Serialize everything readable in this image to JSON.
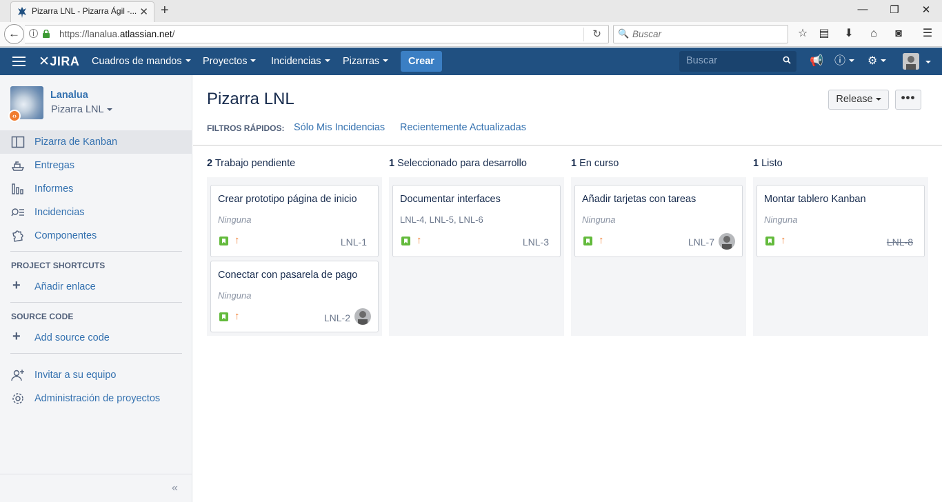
{
  "browser": {
    "tab_title": "Pizarra LNL - Pizarra Ágil -...",
    "url_prefix": "https://lanalua.",
    "url_domain": "atlassian.net",
    "url_suffix": "/",
    "search_placeholder": "Buscar"
  },
  "header": {
    "logo": "JIRA",
    "nav": [
      "Cuadros de mandos",
      "Proyectos",
      "Incidencias",
      "Pizarras"
    ],
    "create_label": "Crear",
    "search_placeholder": "Buscar"
  },
  "sidebar": {
    "project_name": "Lanalua",
    "board_name": "Pizarra LNL",
    "items": [
      {
        "label": "Pizarra de Kanban",
        "icon": "board-icon",
        "active": true
      },
      {
        "label": "Entregas",
        "icon": "ship-icon"
      },
      {
        "label": "Informes",
        "icon": "reports-icon"
      },
      {
        "label": "Incidencias",
        "icon": "issues-icon"
      },
      {
        "label": "Componentes",
        "icon": "components-icon"
      }
    ],
    "project_shortcuts_heading": "PROJECT SHORTCUTS",
    "add_link_label": "Añadir enlace",
    "source_code_heading": "SOURCE CODE",
    "add_source_label": "Add source code",
    "invite_label": "Invitar a su equipo",
    "admin_label": "Administración de proyectos",
    "collapse_glyph": "«"
  },
  "board": {
    "title": "Pizarra LNL",
    "release_label": "Release",
    "more_label": "•••",
    "quick_filters_label": "FILTROS RÁPIDOS:",
    "quick_filters": [
      "Sólo Mis Incidencias",
      "Recientemente Actualizadas"
    ],
    "columns": [
      {
        "count": "2",
        "name": "Trabajo pendiente",
        "cards": [
          {
            "title": "Crear prototipo página de inicio",
            "epic": "Ninguna",
            "key": "LNL-1"
          },
          {
            "title": "Conectar con pasarela de pago",
            "epic": "Ninguna",
            "key": "LNL-2"
          }
        ]
      },
      {
        "count": "1",
        "name": "Seleccionado para desarrollo",
        "cards": [
          {
            "title": "Documentar interfaces",
            "epic": "LNL-4, LNL-5, LNL-6",
            "key": "LNL-3"
          }
        ]
      },
      {
        "count": "1",
        "name": "En curso",
        "cards": [
          {
            "title": "Añadir tarjetas con tareas",
            "epic": "Ninguna",
            "key": "LNL-7"
          }
        ]
      },
      {
        "count": "1",
        "name": "Listo",
        "cards": [
          {
            "title": "Montar tablero Kanban",
            "epic": "Ninguna",
            "key": "LNL-8"
          }
        ]
      }
    ]
  },
  "colors": {
    "header": "#205081",
    "link": "#3572b0",
    "story": "#63ba3c",
    "priority": "#f07c2e"
  }
}
